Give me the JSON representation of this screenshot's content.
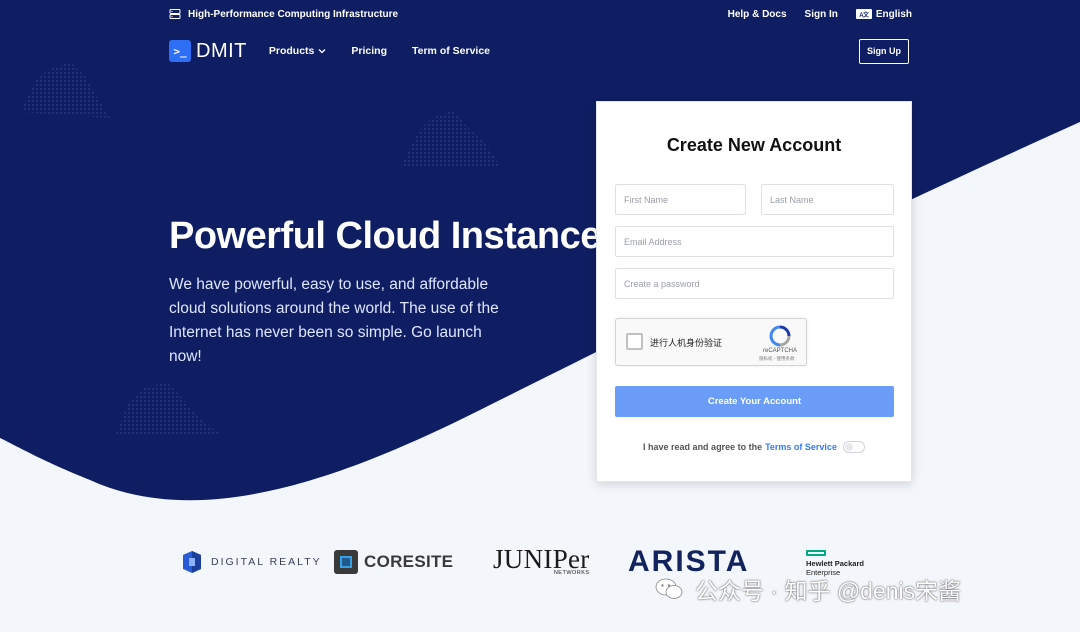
{
  "colors": {
    "hero_bg": "#0f1e63",
    "page_bg": "#f3f6fb",
    "accent": "#2f6ff6",
    "button": "#6a9cf8",
    "link": "#3579f6"
  },
  "topbar": {
    "tagline": "High-Performance Computing Infrastructure",
    "tagline_icon": "server-icon",
    "help": "Help & Docs",
    "sign_in": "Sign In",
    "language_icon": "translate-icon",
    "language": "English"
  },
  "nav": {
    "logo_text": "DMIT",
    "logo_icon": "terminal-icon",
    "products": "Products",
    "pricing": "Pricing",
    "terms": "Term of Service",
    "sign_up": "Sign Up"
  },
  "hero": {
    "title": "Powerful Cloud Instance",
    "description": "We have powerful, easy to use, and affordable cloud solutions around the world. The use of the Internet has never been so simple. Go launch now!"
  },
  "signup_form": {
    "title": "Create New Account",
    "first_name_placeholder": "First Name",
    "last_name_placeholder": "Last Name",
    "email_placeholder": "Email Address",
    "password_placeholder": "Create a password",
    "captcha_label": "进行人机身份验证",
    "captcha_brand": "reCAPTCHA",
    "captcha_sub": "隐私权 - 使用条款",
    "submit": "Create Your Account",
    "agree_text": "I have read and agree to the",
    "terms_link": "Terms of Service"
  },
  "partners": {
    "digital_realty": "DIGITAL REALTY",
    "coresite": "CORESITE",
    "juniper": "JUNIPer",
    "juniper_sub": "NETWORKS",
    "arista": "ARISTA",
    "hpe_line1": "Hewlett Packard",
    "hpe_line2": "Enterprise"
  },
  "watermark": {
    "text": "公众号 · 知乎 @denis宋酱",
    "icon": "wechat-icon"
  }
}
